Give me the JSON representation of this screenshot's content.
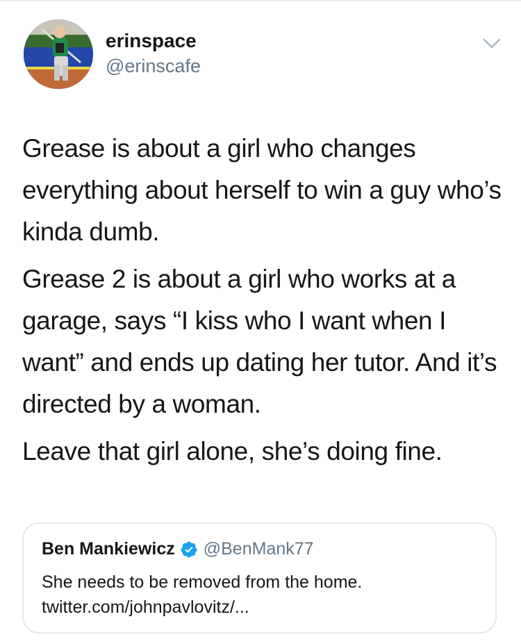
{
  "tweet": {
    "author": {
      "display_name": "erinspace",
      "handle": "@erinscafe"
    },
    "paragraphs": [
      "Grease is about a girl who changes everything about herself to win a guy who’s kinda dumb.",
      "Grease 2 is about a girl who works at a garage, says “I kiss who I want when I want” and ends up dating her tutor. And it’s directed by a woman.",
      "Leave that girl alone, she’s doing fine."
    ],
    "more_icon": "chevron-down-icon"
  },
  "quoted_tweet": {
    "author": {
      "display_name": "Ben Mankiewicz",
      "handle": "@BenMank77",
      "verified": true
    },
    "text": "She needs to be removed from the home.",
    "link": "twitter.com/johnpavlovitz/..."
  },
  "colors": {
    "text": "#14171a",
    "secondary": "#657786",
    "verified_blue": "#1da1f2",
    "border": "#e1e8ed"
  }
}
